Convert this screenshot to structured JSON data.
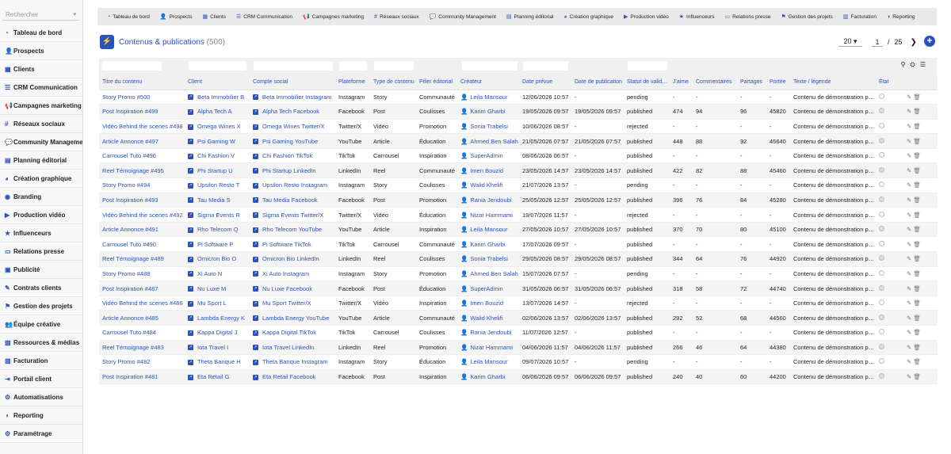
{
  "search": {
    "placeholder": "Rechercher"
  },
  "sidebar": {
    "items": [
      {
        "label": "Tableau de bord",
        "icon": "dashboard-icon",
        "glyph": "◔"
      },
      {
        "label": "Prospects",
        "icon": "user-plus-icon",
        "glyph": "👤"
      },
      {
        "label": "Clients",
        "icon": "building-icon",
        "glyph": "▦"
      },
      {
        "label": "CRM Communication",
        "icon": "list-icon",
        "glyph": "☰"
      },
      {
        "label": "Campagnes marketing",
        "icon": "bullhorn-icon",
        "glyph": "📢"
      },
      {
        "label": "Réseaux sociaux",
        "icon": "hashtag-icon",
        "glyph": "#"
      },
      {
        "label": "Community Manageme",
        "icon": "comments-icon",
        "glyph": "💬"
      },
      {
        "label": "Planning éditorial",
        "icon": "calendar-icon",
        "glyph": "▤"
      },
      {
        "label": "Création graphique",
        "icon": "palette-icon",
        "glyph": "◕"
      },
      {
        "label": "Branding",
        "icon": "brand-icon",
        "glyph": "◉"
      },
      {
        "label": "Production vidéo",
        "icon": "video-icon",
        "glyph": "▶"
      },
      {
        "label": "Influenceurs",
        "icon": "star-icon",
        "glyph": "★"
      },
      {
        "label": "Relations presse",
        "icon": "newspaper-icon",
        "glyph": "▭"
      },
      {
        "label": "Publicité",
        "icon": "ad-icon",
        "glyph": "▣"
      },
      {
        "label": "Contrats clients",
        "icon": "contract-icon",
        "glyph": "✎"
      },
      {
        "label": "Gestion des projets",
        "icon": "project-icon",
        "glyph": "⚑"
      },
      {
        "label": "Équipe créative",
        "icon": "team-icon",
        "glyph": "👥"
      },
      {
        "label": "Ressources & médias",
        "icon": "media-icon",
        "glyph": "▨"
      },
      {
        "label": "Facturation",
        "icon": "invoice-icon",
        "glyph": "▥"
      },
      {
        "label": "Portail client",
        "icon": "portal-icon",
        "glyph": "⇥"
      },
      {
        "label": "Automatisations",
        "icon": "robot-icon",
        "glyph": "⚙"
      },
      {
        "label": "Reporting",
        "icon": "chart-icon",
        "glyph": "◑"
      },
      {
        "label": "Paramétrage",
        "icon": "gear-icon",
        "glyph": "⚙"
      }
    ]
  },
  "topbar": {
    "items": [
      {
        "label": "Tableau de bord",
        "icon": "dashboard-icon",
        "glyph": "◔"
      },
      {
        "label": "Prospects",
        "icon": "user-plus-icon",
        "glyph": "👤"
      },
      {
        "label": "Clients",
        "icon": "building-icon",
        "glyph": "▦"
      },
      {
        "label": "CRM Communication",
        "icon": "list-icon",
        "glyph": "☰"
      },
      {
        "label": "Campagnes marketing",
        "icon": "bullhorn-icon",
        "glyph": "📢"
      },
      {
        "label": "Réseaux sociaux",
        "icon": "hashtag-icon",
        "glyph": "#"
      },
      {
        "label": "Community Management",
        "icon": "comments-icon",
        "glyph": "💬"
      },
      {
        "label": "Planning éditorial",
        "icon": "calendar-icon",
        "glyph": "▤"
      },
      {
        "label": "Création graphique",
        "icon": "palette-icon",
        "glyph": "◕"
      },
      {
        "label": "Production vidéo",
        "icon": "video-icon",
        "glyph": "▶"
      },
      {
        "label": "Influenceurs",
        "icon": "star-icon",
        "glyph": "★"
      },
      {
        "label": "Relations presse",
        "icon": "newspaper-icon",
        "glyph": "▭"
      },
      {
        "label": "Gestion des projets",
        "icon": "project-icon",
        "glyph": "⚑"
      },
      {
        "label": "Facturation",
        "icon": "invoice-icon",
        "glyph": "▥"
      },
      {
        "label": "Reporting",
        "icon": "chart-icon",
        "glyph": "◑"
      }
    ]
  },
  "page": {
    "title": "Contenus & publications",
    "count": "(500)"
  },
  "pager": {
    "page_size": "20",
    "current": "1",
    "sep": "/",
    "total": "25"
  },
  "table": {
    "columns": [
      "Titre du contenu",
      "Client",
      "Compte social",
      "Plateforme",
      "Type de contenu",
      "Pilier éditorial",
      "Créateur",
      "Date prévue",
      "Date de publication",
      "Statut de validation",
      "J'aime",
      "Commentaires",
      "Partages",
      "Portée",
      "Texte / légende",
      "État"
    ],
    "rows": [
      [
        "Story Promo #500",
        "Beta Immobilier B",
        "Beta Immobilier Instagram",
        "Instagram",
        "Story",
        "Communauté",
        "Leila Mansour",
        "12/06/2026 10:57",
        "-",
        "pending",
        "-",
        "-",
        "-",
        "-",
        "Contenu de démonstration pour ...",
        "on"
      ],
      [
        "Post Inspiration #499",
        "Alpha Tech A",
        "Alpha Tech Facebook",
        "Facebook",
        "Post",
        "Coulisses",
        "Karim Gharbi",
        "19/05/2026 09:57",
        "19/05/2026 09:57",
        "published",
        "474",
        "94",
        "96",
        "45820",
        "Contenu de démonstration pour ...",
        "off"
      ],
      [
        "Vidéo Behind the scenes #498",
        "Omega Wines X",
        "Omega Wines Twitter/X",
        "Twitter/X",
        "Vidéo",
        "Promotion",
        "Sonia Trabelsi",
        "10/06/2026 08:57",
        "-",
        "rejected",
        "-",
        "-",
        "-",
        "-",
        "Contenu de démonstration pour ...",
        "on"
      ],
      [
        "Article Annonce #497",
        "Psi Gaming W",
        "Psi Gaming YouTube",
        "YouTube",
        "Article",
        "Éducation",
        "Ahmed Ben Salah",
        "21/05/2026 07:57",
        "21/05/2026 07:57",
        "published",
        "448",
        "88",
        "92",
        "45640",
        "Contenu de démonstration pour ...",
        "off"
      ],
      [
        "Carrousel Tuto #496",
        "Chi Fashion V",
        "Chi Fashion TikTok",
        "TikTok",
        "Carrousel",
        "Inspiration",
        "SuperAdmin",
        "08/06/2026 06:57",
        "-",
        "published",
        "-",
        "-",
        "-",
        "-",
        "Contenu de démonstration pour ...",
        "on"
      ],
      [
        "Reel Témoignage #495",
        "Phi Startup U",
        "Phi Startup LinkedIn",
        "LinkedIn",
        "Reel",
        "Communauté",
        "Imen Bouzid",
        "23/05/2026 14:57",
        "23/05/2026 14:57",
        "published",
        "422",
        "82",
        "88",
        "45460",
        "Contenu de démonstration pour ...",
        "off"
      ],
      [
        "Story Promo #494",
        "Upsilon Resto T",
        "Upsilon Resto Instagram",
        "Instagram",
        "Story",
        "Coulisses",
        "Walid Khelifi",
        "21/07/2026 13:57",
        "-",
        "pending",
        "-",
        "-",
        "-",
        "-",
        "Contenu de démonstration pour ...",
        "on"
      ],
      [
        "Post Inspiration #493",
        "Tau Media S",
        "Tau Media Facebook",
        "Facebook",
        "Post",
        "Promotion",
        "Rania Jendoubi",
        "25/05/2026 12:57",
        "25/05/2026 12:57",
        "published",
        "396",
        "76",
        "84",
        "45280",
        "Contenu de démonstration pour ...",
        "off"
      ],
      [
        "Vidéo Behind the scenes #492",
        "Sigma Events R",
        "Sigma Events Twitter/X",
        "Twitter/X",
        "Vidéo",
        "Éducation",
        "Nizar Hammami",
        "19/07/2026 11:57",
        "-",
        "rejected",
        "-",
        "-",
        "-",
        "-",
        "Contenu de démonstration pour ...",
        "on"
      ],
      [
        "Article Annonce #491",
        "Rho Telecom Q",
        "Rho Telecom YouTube",
        "YouTube",
        "Article",
        "Inspiration",
        "Leila Mansour",
        "27/05/2026 10:57",
        "27/05/2026 10:57",
        "published",
        "370",
        "70",
        "80",
        "45100",
        "Contenu de démonstration pour ...",
        "off"
      ],
      [
        "Carrousel Tuto #490",
        "Pi Software P",
        "Pi Software TikTok",
        "TikTok",
        "Carrousel",
        "Communauté",
        "Karim Gharbi",
        "17/07/2026 09:57",
        "-",
        "published",
        "-",
        "-",
        "-",
        "-",
        "Contenu de démonstration pour ...",
        "on"
      ],
      [
        "Reel Témoignage #489",
        "Omicron Bio O",
        "Omicron Bio LinkedIn",
        "LinkedIn",
        "Reel",
        "Coulisses",
        "Sonia Trabelsi",
        "29/05/2026 08:57",
        "29/05/2026 08:57",
        "published",
        "344",
        "64",
        "76",
        "44920",
        "Contenu de démonstration pour ...",
        "off"
      ],
      [
        "Story Promo #488",
        "Xi Auto N",
        "Xi Auto Instagram",
        "Instagram",
        "Story",
        "Promotion",
        "Ahmed Ben Salah",
        "15/07/2026 07:57",
        "-",
        "pending",
        "-",
        "-",
        "-",
        "-",
        "Contenu de démonstration pour ...",
        "on"
      ],
      [
        "Post Inspiration #487",
        "Nu Luxe M",
        "Nu Luxe Facebook",
        "Facebook",
        "Post",
        "Éducation",
        "SuperAdmin",
        "31/05/2026 06:57",
        "31/05/2026 06:57",
        "published",
        "318",
        "58",
        "72",
        "44740",
        "Contenu de démonstration pour ...",
        "off"
      ],
      [
        "Vidéo Behind the scenes #486",
        "Mu Sport L",
        "Mu Sport Twitter/X",
        "Twitter/X",
        "Vidéo",
        "Inspiration",
        "Imen Bouzid",
        "13/07/2026 14:57",
        "-",
        "rejected",
        "-",
        "-",
        "-",
        "-",
        "Contenu de démonstration pour ...",
        "on"
      ],
      [
        "Article Annonce #485",
        "Lambda Energy K",
        "Lambda Energy YouTube",
        "YouTube",
        "Article",
        "Communauté",
        "Walid Khelifi",
        "02/06/2026 13:57",
        "02/06/2026 13:57",
        "published",
        "292",
        "52",
        "68",
        "44560",
        "Contenu de démonstration pour ...",
        "off"
      ],
      [
        "Carrousel Tuto #484",
        "Kappa Digital J",
        "Kappa Digital TikTok",
        "TikTok",
        "Carrousel",
        "Coulisses",
        "Rania Jendoubi",
        "11/07/2026 12:57",
        "-",
        "published",
        "-",
        "-",
        "-",
        "-",
        "Contenu de démonstration pour ...",
        "on"
      ],
      [
        "Reel Témoignage #483",
        "Iota Travel I",
        "Iota Travel LinkedIn",
        "LinkedIn",
        "Reel",
        "Promotion",
        "Nizar Hammami",
        "04/06/2026 11:57",
        "04/06/2026 11:57",
        "published",
        "266",
        "46",
        "64",
        "44380",
        "Contenu de démonstration pour ...",
        "off"
      ],
      [
        "Story Promo #482",
        "Theta Banque H",
        "Theta Banque Instagram",
        "Instagram",
        "Story",
        "Éducation",
        "Leila Mansour",
        "09/07/2026 10:57",
        "-",
        "pending",
        "-",
        "-",
        "-",
        "-",
        "Contenu de démonstration pour ...",
        "on"
      ],
      [
        "Post Inspiration #481",
        "Eta Retail G",
        "Eta Retail Facebook",
        "Facebook",
        "Post",
        "Inspiration",
        "Karim Gharbi",
        "06/06/2026 09:57",
        "06/06/2026 09:57",
        "published",
        "240",
        "40",
        "60",
        "44200",
        "Contenu de démonstration pour ...",
        "off"
      ]
    ]
  },
  "colors": {
    "accent": "#2a52be",
    "header_bg": "#f0f0f0",
    "row_alt": "#f4f4f4"
  }
}
